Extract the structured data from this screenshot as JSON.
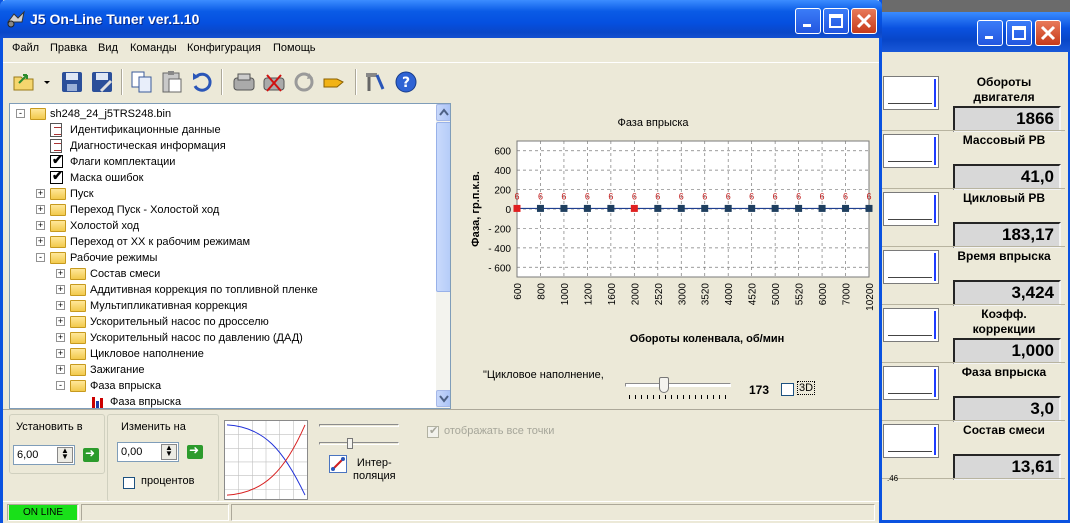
{
  "window": {
    "title": "J5 On-Line Tuner ver.1.10"
  },
  "menu": [
    "Файл",
    "Правка",
    "Вид",
    "Команды",
    "Конфигурация",
    "Помощь"
  ],
  "toolbar": {
    "icons": [
      "open-icon",
      "dropdown-arrow-icon",
      "save-icon",
      "save-as-icon",
      "copy-icon",
      "paste-icon",
      "undo-icon",
      "ecu-read-icon",
      "ecu-write-icon",
      "refresh-icon",
      "connect-icon",
      "tools-icon",
      "help-icon"
    ]
  },
  "tree": {
    "root": "sh248_24_j5TRS248.bin",
    "items": [
      {
        "label": "Идентификационные данные",
        "icon": "doc"
      },
      {
        "label": "Диагностическая информация",
        "icon": "doc"
      },
      {
        "label": "Флаги комплектации",
        "icon": "check"
      },
      {
        "label": "Маска ошибок",
        "icon": "check"
      },
      {
        "label": "Пуск",
        "icon": "folder"
      },
      {
        "label": "Переход Пуск - Холостой ход",
        "icon": "folder"
      },
      {
        "label": "Холостой ход",
        "icon": "folder"
      },
      {
        "label": "Переход от ХХ к рабочим режимам",
        "icon": "folder"
      },
      {
        "label": "Рабочие режимы",
        "icon": "folder-open"
      },
      {
        "label": "Состав смеси",
        "icon": "folder"
      },
      {
        "label": "Аддитивная коррекция по топливной пленке",
        "icon": "folder"
      },
      {
        "label": "Мультипликативная коррекция",
        "icon": "folder"
      },
      {
        "label": "Ускорительный насос по дросселю",
        "icon": "folder"
      },
      {
        "label": "Ускорительный насос по давлению (ДАД)",
        "icon": "folder"
      },
      {
        "label": "Цикловое наполнение",
        "icon": "folder"
      },
      {
        "label": "Зажигание",
        "icon": "folder"
      },
      {
        "label": "Фаза впрыска",
        "icon": "folder-open"
      },
      {
        "label": "Фаза впрыска",
        "icon": "chart"
      }
    ]
  },
  "chart_data": {
    "type": "line",
    "title": "Фаза впрыска",
    "xlabel": "Обороты коленвала, об/мин",
    "ylabel": "Фаза, гр.п.к.в.",
    "categories": [
      "600",
      "800",
      "1000",
      "1200",
      "1600",
      "2000",
      "2520",
      "3000",
      "3520",
      "4000",
      "4520",
      "5000",
      "5520",
      "6000",
      "7000",
      "10200"
    ],
    "series": [
      {
        "values": [
          6,
          6,
          6,
          6,
          6,
          6,
          6,
          6,
          6,
          6,
          6,
          6,
          6,
          6,
          6,
          6
        ]
      }
    ],
    "data_labels": [
      "6",
      "6",
      "6",
      "6",
      "6",
      "6",
      "6",
      "6",
      "6",
      "6",
      "6",
      "6",
      "6",
      "6",
      "6",
      "6"
    ],
    "highlighted_points": [
      0,
      5
    ],
    "yticks": [
      "600",
      "400",
      "200",
      "0",
      "- 200",
      "- 400",
      "- 600"
    ],
    "ylim": [
      -700,
      700
    ],
    "grid": true,
    "colors": {
      "line": "#1f3f8f",
      "point": "#1f3f5f",
      "highlight": "#e02020",
      "label": "#c01818",
      "grid": "#7a7a7a"
    }
  },
  "slider": {
    "caption": "\"Цикловое наполнение,",
    "value": "173",
    "position": 0.35
  },
  "checkbox_3d": {
    "label": "3D",
    "checked": false
  },
  "controls": {
    "set_label": "Установить в",
    "set_value": "6,00",
    "change_label": "Изменить на",
    "change_value": "0,00",
    "percent_label": "процентов",
    "interp_label": "Интер-\nполяция",
    "show_all_points_label": "отображать все точки"
  },
  "status": {
    "online": "ON LINE"
  },
  "gauges": [
    {
      "label": "Обороты двигателя",
      "value": "1866"
    },
    {
      "label": "Массовый РВ",
      "value": "41,0"
    },
    {
      "label": "Цикловый РВ",
      "value": "183,17"
    },
    {
      "label": "Время впрыска",
      "value": "3,424"
    },
    {
      "label": "Коэфф. коррекции",
      "value": "1,000"
    },
    {
      "label": "Фаза впрыска",
      "value": "3,0"
    },
    {
      "label": "Состав смеси",
      "value": "13,61"
    }
  ],
  "gauge_thumb_caption": ".46"
}
